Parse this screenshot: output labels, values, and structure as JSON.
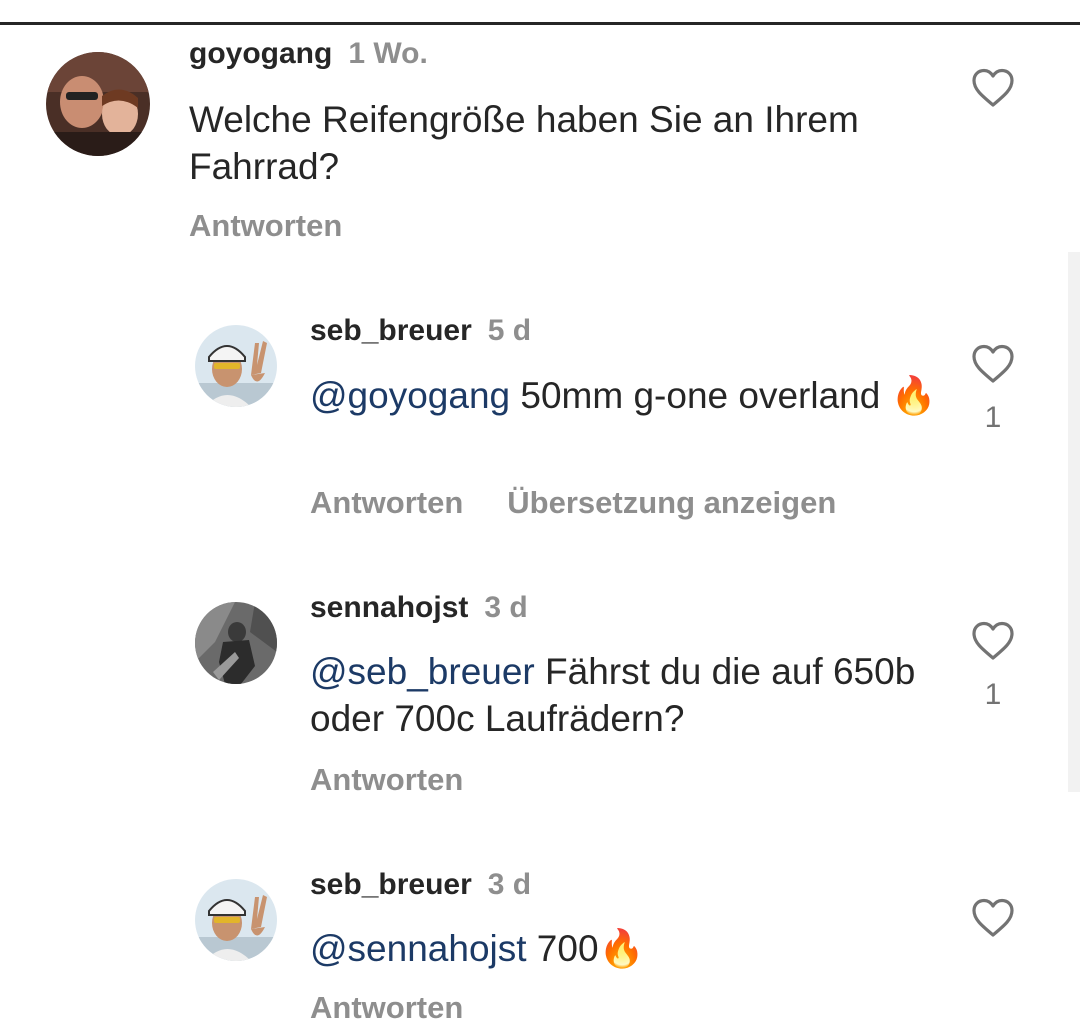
{
  "comments": [
    {
      "username": "goyogang",
      "time": "1 Wo.",
      "mention": "",
      "text": "Welche Reifengröße haben Sie an Ihrem Fahrrad?",
      "reply_label": "Antworten",
      "translate_label": "",
      "like_count": ""
    },
    {
      "username": "seb_breuer",
      "time": "5 d",
      "mention": "@goyogang",
      "text": " 50mm g-one overland 🔥",
      "reply_label": "Antworten",
      "translate_label": "Übersetzung anzeigen",
      "like_count": "1"
    },
    {
      "username": "sennahojst",
      "time": "3 d",
      "mention": "@seb_breuer",
      "text": " Fährst du die auf 650b oder 700c Laufrädern?",
      "reply_label": "Antworten",
      "translate_label": "",
      "like_count": "1"
    },
    {
      "username": "seb_breuer",
      "time": "3 d",
      "mention": "@sennahojst",
      "text": " 700🔥",
      "reply_label": "Antworten",
      "translate_label": "",
      "like_count": ""
    }
  ],
  "icons": {
    "like": "heart-outline-icon"
  },
  "colors": {
    "mention": "#1c3a66",
    "secondary": "#8e8e8e",
    "text": "#262626"
  }
}
